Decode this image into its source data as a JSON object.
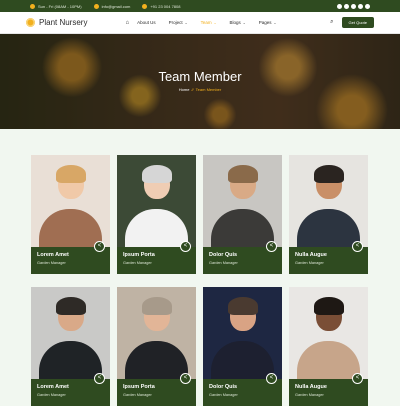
{
  "topbar": {
    "hours": "Sun - Fri (08AM - 10PM)",
    "email": "info@gmail.com",
    "phone": "+91 23 004 7808"
  },
  "nav": {
    "logo": "Plant Nursery",
    "items": [
      {
        "label": "About Us",
        "chevron": false,
        "active": false
      },
      {
        "label": "Project",
        "chevron": true,
        "active": false
      },
      {
        "label": "Team",
        "chevron": true,
        "active": true
      },
      {
        "label": "Blogs",
        "chevron": true,
        "active": false
      },
      {
        "label": "Pages",
        "chevron": true,
        "active": false
      }
    ],
    "cta": "Get Quote"
  },
  "hero": {
    "title": "Team Member",
    "crumb_home": "Home",
    "crumb_sep": "//",
    "crumb_current": "Team Member"
  },
  "team": [
    {
      "name": "Lorem Amet",
      "role": "Garden Manager",
      "bg": "#e9dfd6",
      "skin": "#f0c9a8",
      "hair": "#d8a766",
      "suit": "#a06e52"
    },
    {
      "name": "Ipsum Porta",
      "role": "Garden Manager",
      "bg": "#3c4a36",
      "skin": "#efcdb4",
      "hair": "#d6d6d6",
      "suit": "#f2f2f2"
    },
    {
      "name": "Dolor Quis",
      "role": "Garden Manager",
      "bg": "#c8c6c2",
      "skin": "#d9aa86",
      "hair": "#8a6a4a",
      "suit": "#3b3a38"
    },
    {
      "name": "Nulla Augue",
      "role": "Garden Manager",
      "bg": "#e6e4e0",
      "skin": "#c98f67",
      "hair": "#2a2420",
      "suit": "#2c3440"
    },
    {
      "name": "Lorem Amet",
      "role": "Garden Manager",
      "bg": "#c9c9c7",
      "skin": "#d9a988",
      "hair": "#2e2a26",
      "suit": "#1f2326"
    },
    {
      "name": "Ipsum Porta",
      "role": "Garden Manager",
      "bg": "#bfb3a4",
      "skin": "#e2b597",
      "hair": "#a79a8a",
      "suit": "#202226"
    },
    {
      "name": "Dolor Quis",
      "role": "Garden Manager",
      "bg": "#1e2742",
      "skin": "#d9a384",
      "hair": "#4a3a30",
      "suit": "#1d2030"
    },
    {
      "name": "Nulla Augue",
      "role": "Garden Manager",
      "bg": "#e9e7e4",
      "skin": "#7a4e36",
      "hair": "#1e1814",
      "suit": "#c7a58a"
    }
  ]
}
